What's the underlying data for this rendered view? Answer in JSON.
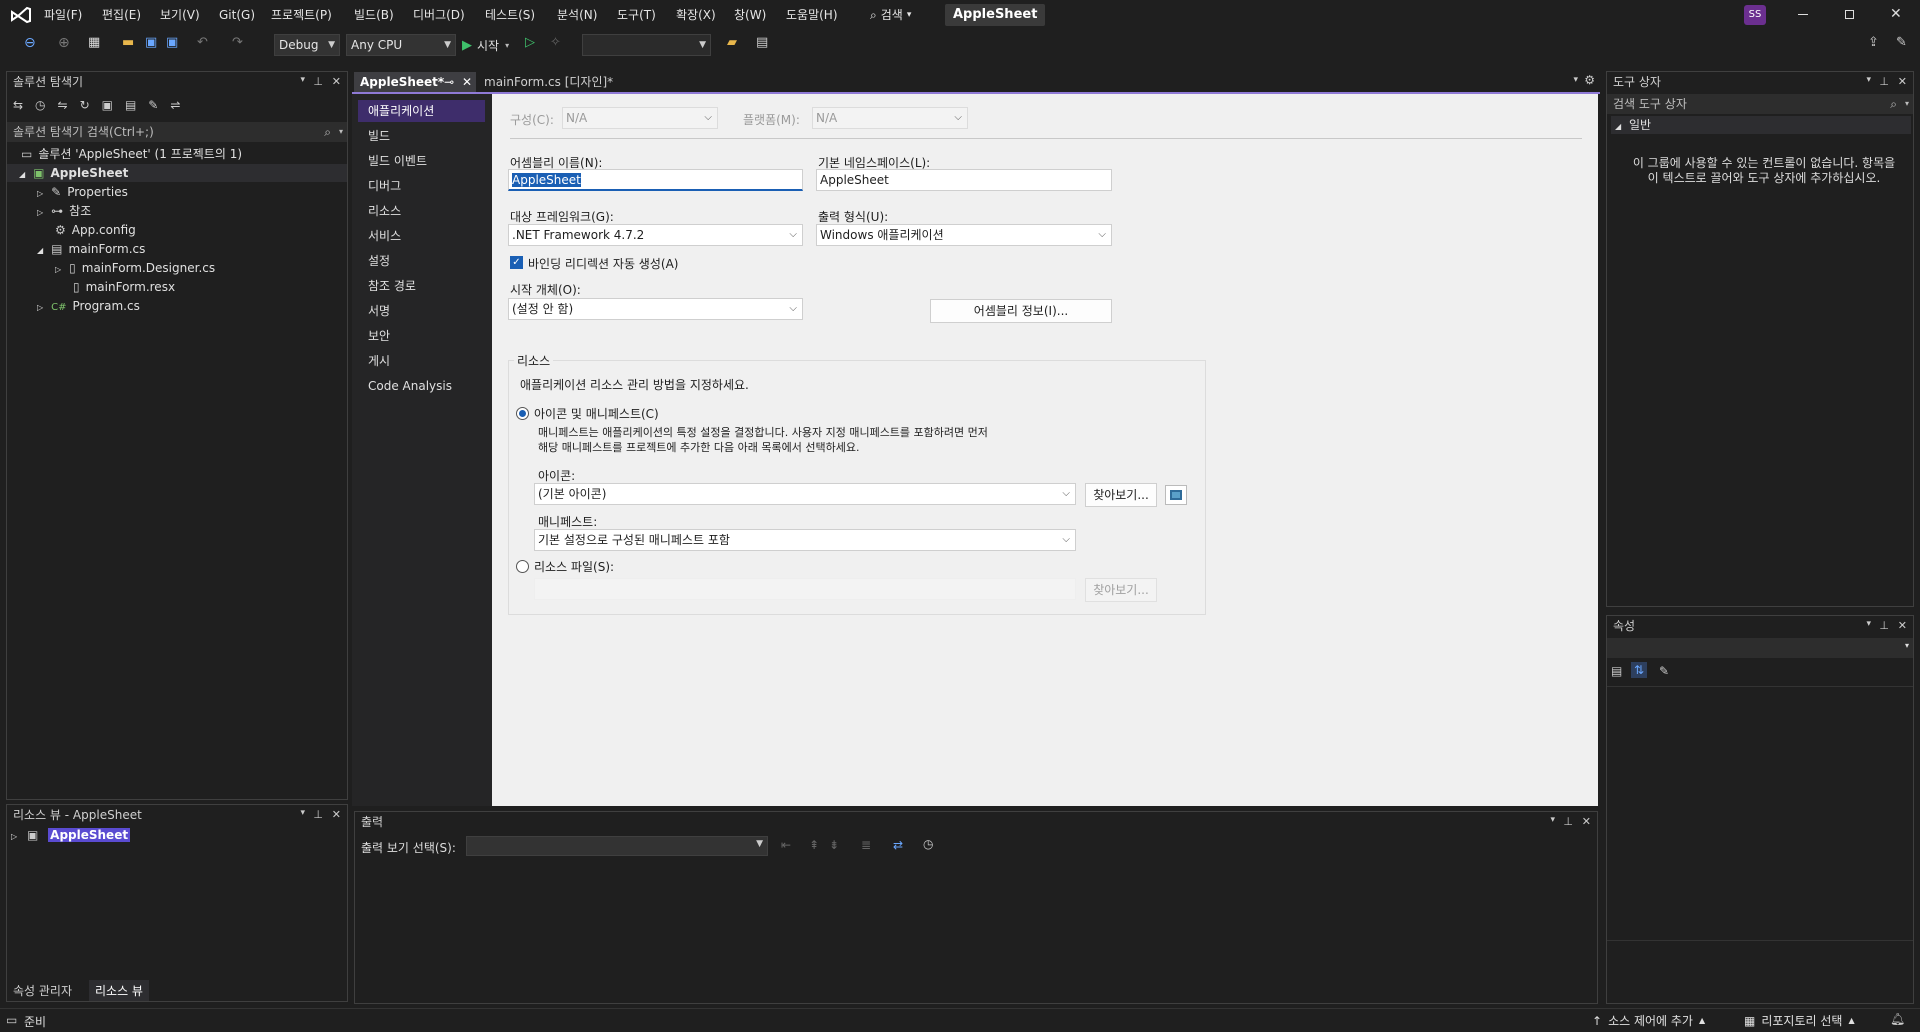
{
  "menu": [
    "파일(F)",
    "편집(E)",
    "보기(V)",
    "Git(G)",
    "프로젝트(P)",
    "빌드(B)",
    "디버그(D)",
    "테스트(S)",
    "분석(N)",
    "도구(T)",
    "확장(X)",
    "창(W)",
    "도움말(H)"
  ],
  "search_label": "검색",
  "project_title": "AppleSheet",
  "user_initials": "SS",
  "toolbar": {
    "config": "Debug",
    "platform": "Any CPU",
    "start_label": "시작"
  },
  "solution_explorer": {
    "title": "솔루션 탐색기",
    "search_placeholder": "솔루션 탐색기 검색(Ctrl+;)",
    "items": [
      "솔루션 'AppleSheet' (1 프로젝트의 1)",
      "AppleSheet",
      "Properties",
      "참조",
      "App.config",
      "mainForm.cs",
      "mainForm.Designer.cs",
      "mainForm.resx",
      "Program.cs"
    ]
  },
  "resource_view": {
    "title": "리소스 뷰 - AppleSheet",
    "item": "AppleSheet",
    "tabs": [
      "속성 관리자",
      "리소스 뷰"
    ]
  },
  "tabs": {
    "active": "AppleSheet*",
    "other": "mainForm.cs [디자인]*"
  },
  "nav": [
    "애플리케이션",
    "빌드",
    "빌드 이벤트",
    "디버그",
    "리소스",
    "서비스",
    "설정",
    "참조 경로",
    "서명",
    "보안",
    "게시",
    "Code Analysis"
  ],
  "app_page": {
    "config_label": "구성(C):",
    "config_value": "N/A",
    "platform_label": "플랫폼(M):",
    "platform_value": "N/A",
    "assembly_label": "어셈블리 이름(N):",
    "assembly_value": "AppleSheet",
    "namespace_label": "기본 네임스페이스(L):",
    "namespace_value": "AppleSheet",
    "framework_label": "대상 프레임워크(G):",
    "framework_value": ".NET Framework 4.7.2",
    "output_label": "출력 형식(U):",
    "output_value": "Windows 애플리케이션",
    "binding_label": "바인딩 리디렉션 자동 생성(A)",
    "startup_label": "시작 개체(O):",
    "startup_value": "(설정 안 함)",
    "assembly_info_button": "어셈블리 정보(I)...",
    "resources_group": "리소스",
    "resources_desc": "애플리케이션 리소스 관리 방법을 지정하세요.",
    "icon_manifest_label": "아이콘 및 매니페스트(C)",
    "icon_manifest_desc1": "매니페스트는 애플리케이션의 특정 설정을 결정합니다. 사용자 지정 매니페스트를 포함하려면 먼저",
    "icon_manifest_desc2": "해당 매니페스트를 프로젝트에 추가한 다음 아래 목록에서 선택하세요.",
    "icon_label": "아이콘:",
    "icon_value": "(기본 아이콘)",
    "browse_button": "찾아보기...",
    "manifest_label": "매니페스트:",
    "manifest_value": "기본 설정으로 구성된 매니페스트 포함",
    "resource_file_label": "리소스 파일(S):",
    "browse2_button": "찾아보기..."
  },
  "output": {
    "title": "출력",
    "source_label": "출력 보기 선택(S):"
  },
  "toolbox": {
    "title": "도구 상자",
    "search_placeholder": "검색 도구 상자",
    "section": "일반",
    "empty_msg1": "이 그룹에 사용할 수 있는 컨트롤이 없습니다. 항목을",
    "empty_msg2": "이 텍스트로 끌어와 도구 상자에 추가하십시오."
  },
  "properties": {
    "title": "속성"
  },
  "status": {
    "ready": "준비",
    "source_control": "소스 제어에 추가",
    "repo": "리포지토리 선택"
  },
  "colors": {
    "accent": "#8f7ad6",
    "selection": "#3e2d6b",
    "vs_logo": "#ffffff"
  }
}
